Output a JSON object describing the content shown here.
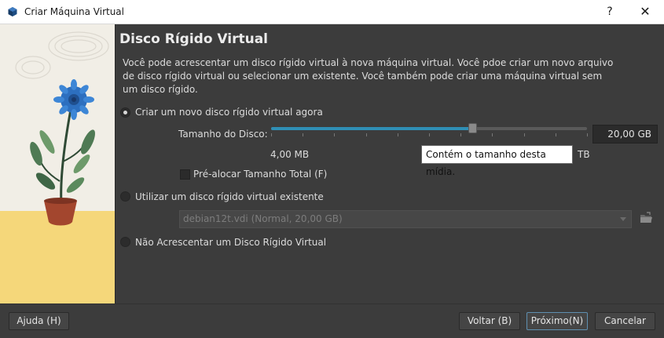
{
  "window": {
    "title": "Criar Máquina Virtual",
    "help_glyph": "?",
    "close_glyph": "✕"
  },
  "page": {
    "heading": "Disco Rígido Virtual",
    "description": "Você pode acrescentar um disco rígido virtual à nova máquina virtual. Você pdoe criar um novo arquivo de disco rígido virtual ou selecionar um existente. Você também pode criar uma máquina virtual sem um disco rígido."
  },
  "options": {
    "create_new": {
      "label": "Criar um novo disco rígido virtual agora",
      "checked": true
    },
    "use_existing": {
      "label": "Utilizar um disco rígido virtual existente",
      "checked": false
    },
    "none": {
      "label": "Não Acrescentar um Disco Rígido Virtual",
      "checked": false
    }
  },
  "disk_size": {
    "label": "Tamanho do Disco:",
    "value": "20,00 GB",
    "min_label": "4,00 MB",
    "max_label": "TB",
    "slider_fraction": 0.64,
    "tooltip": "Contém o tamanho desta mídia."
  },
  "preallocate": {
    "label": "Pré-alocar Tamanho Total (F)",
    "checked": false
  },
  "existing_disk": {
    "selected": "debian12t.vdi (Normal, 20,00 GB)"
  },
  "buttons": {
    "help": "Ajuda (H)",
    "back": "Voltar (B)",
    "next": "Próximo(N)",
    "cancel": "Cancelar"
  },
  "colors": {
    "accent": "#2f8fb5",
    "background": "#3c3c3c"
  },
  "icons": {
    "app": "virtualbox-icon",
    "folder": "folder-open-icon"
  }
}
